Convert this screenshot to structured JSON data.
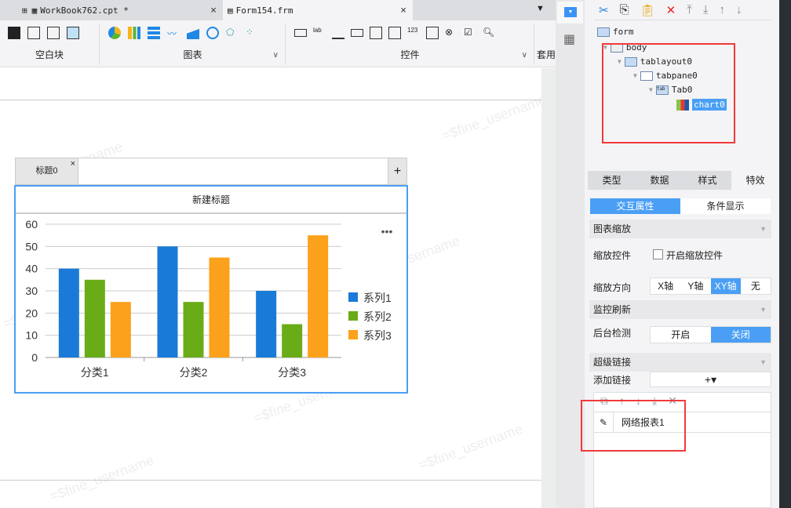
{
  "tabs": [
    {
      "label": "WorkBook762.cpt *"
    },
    {
      "label": "Form154.frm"
    }
  ],
  "ribbon": {
    "groups": [
      {
        "label": "空白块"
      },
      {
        "label": "图表"
      },
      {
        "label": "控件"
      },
      {
        "label": "套用"
      }
    ]
  },
  "widget": {
    "tab_label": "标题0",
    "chart_title": "新建标题"
  },
  "watermark": "=$fine_username",
  "chart_data": {
    "type": "bar",
    "title": "新建标题",
    "categories": [
      "分类1",
      "分类2",
      "分类3"
    ],
    "series": [
      {
        "name": "系列1",
        "values": [
          40,
          50,
          30
        ],
        "color": "#1a7ad8"
      },
      {
        "name": "系列2",
        "values": [
          35,
          25,
          15
        ],
        "color": "#6aac17"
      },
      {
        "name": "系列3",
        "values": [
          25,
          45,
          55
        ],
        "color": "#fca11b"
      }
    ],
    "ylim": [
      0,
      60
    ],
    "yticks": [
      0,
      10,
      20,
      30,
      40,
      50,
      60
    ],
    "legend": "right",
    "grid": true
  },
  "tree": {
    "nodes": [
      "form",
      "body",
      "tablayout0",
      "tabpane0",
      "Tab0",
      "chart0"
    ]
  },
  "panel": {
    "tabs": [
      "类型",
      "数据",
      "样式",
      "特效"
    ],
    "subtabs": [
      "交互属性",
      "条件显示"
    ],
    "zoom_section": "图表缩放",
    "zoom_widget_label": "缩放控件",
    "zoom_widget_checkbox": "开启缩放控件",
    "zoom_dir_label": "缩放方向",
    "zoom_dirs": [
      "X轴",
      "Y轴",
      "XY轴",
      "无"
    ],
    "monitor_section": "监控刷新",
    "bg_check_label": "后台检测",
    "bg_check_options": [
      "开启",
      "关闭"
    ],
    "link_section": "超级链接",
    "add_link_label": "添加链接",
    "add_link_button": "+▾",
    "links": [
      "网络报表1"
    ]
  }
}
